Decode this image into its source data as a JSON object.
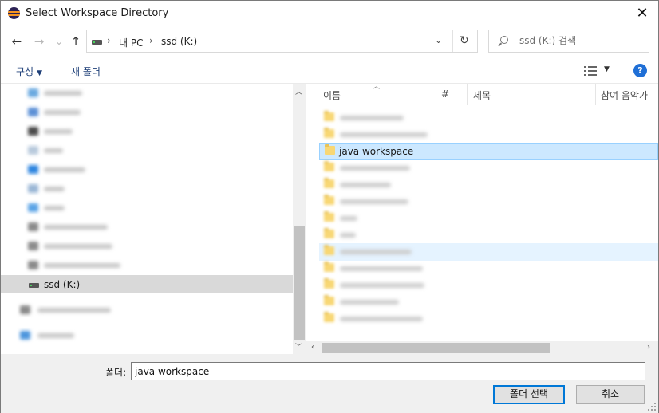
{
  "window": {
    "title": "Select Workspace Directory",
    "close_glyph": "✕"
  },
  "nav": {
    "back_glyph": "←",
    "forward_glyph": "→",
    "recent_glyph": "⌄",
    "up_glyph": "↑",
    "address": {
      "crumbs": [
        "내 PC",
        "ssd (K:)"
      ],
      "separator": "›",
      "dropdown_glyph": "⌄",
      "refresh_glyph": "↻"
    },
    "search": {
      "placeholder": "ssd (K:) 검색"
    }
  },
  "toolbar": {
    "organize_label": "구성",
    "organize_caret": "▼",
    "new_folder_label": "새 폴더",
    "view_caret": "▼",
    "help_glyph": "?"
  },
  "tree": {
    "selected_label": "ssd (K:)",
    "scroll_up_glyph": "︿",
    "scroll_down_glyph": "﹀"
  },
  "list": {
    "columns": [
      "이름",
      "#",
      "제목",
      "참여 음악가"
    ],
    "sort_glyph": "︿",
    "selected_item": "java workspace",
    "scroll_left_glyph": "‹",
    "scroll_right_glyph": "›"
  },
  "footer": {
    "folder_label": "폴더:",
    "folder_value": "java workspace",
    "select_button": "폴더 선택",
    "cancel_button": "취소"
  },
  "colors": {
    "selection": "#cce8ff",
    "selection_border": "#99d1ff",
    "help": "#1f6fd6",
    "primary_button_border": "#0078d7"
  }
}
